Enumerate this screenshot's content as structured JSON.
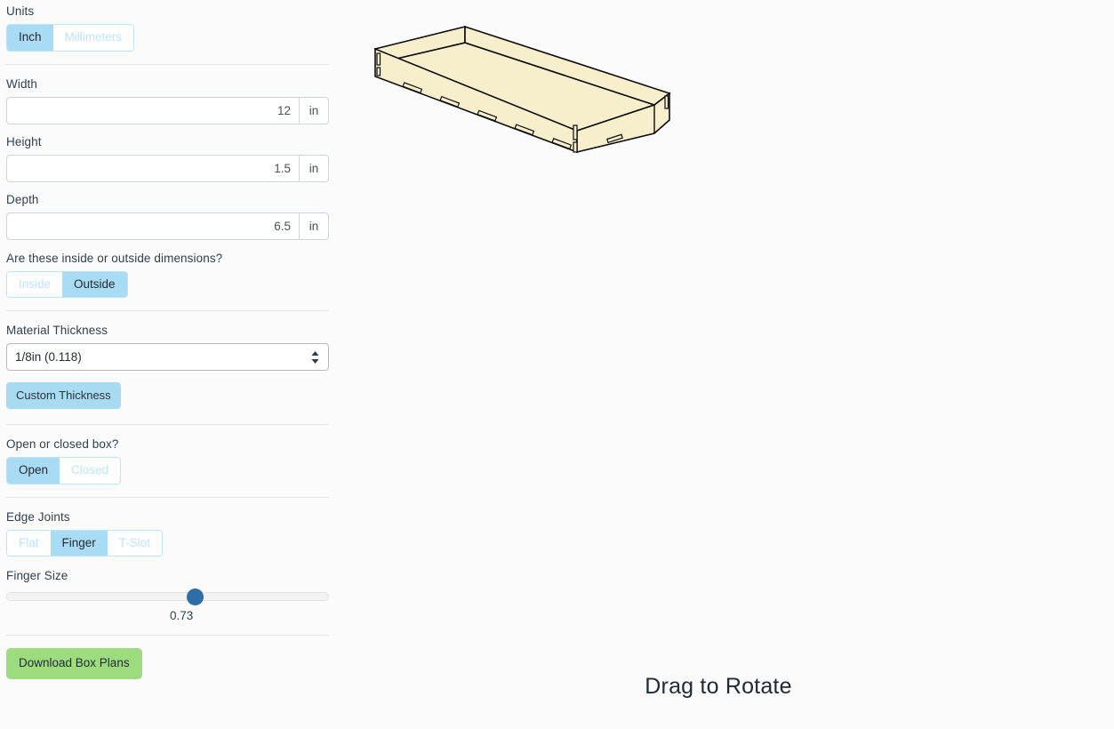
{
  "panel": {
    "units": {
      "label": "Units",
      "options": [
        {
          "label": "Inch",
          "selected": true
        },
        {
          "label": "Millimeters",
          "selected": false
        }
      ]
    },
    "width": {
      "label": "Width",
      "value": "12",
      "unit": "in",
      "placeholder": ""
    },
    "height": {
      "label": "Height",
      "value": "1.5",
      "unit": "in",
      "placeholder": ""
    },
    "depth": {
      "label": "Depth",
      "value": "6.5",
      "unit": "in",
      "placeholder": ""
    },
    "dimension_mode": {
      "label": "Are these inside or outside dimensions?",
      "options": [
        {
          "label": "Inside",
          "selected": false
        },
        {
          "label": "Outside",
          "selected": true
        }
      ]
    },
    "material_thickness": {
      "label": "Material Thickness",
      "selected": "1/8in (0.118)",
      "options": [
        "1/8in (0.118)"
      ],
      "custom_button": "Custom Thickness"
    },
    "box_type": {
      "label": "Open or closed box?",
      "options": [
        {
          "label": "Open",
          "selected": true
        },
        {
          "label": "Closed",
          "selected": false
        }
      ]
    },
    "edge_joints": {
      "label": "Edge Joints",
      "options": [
        {
          "label": "Flat",
          "selected": false
        },
        {
          "label": "Finger",
          "selected": true
        },
        {
          "label": "T-Slot",
          "selected": false
        }
      ]
    },
    "finger_size": {
      "label": "Finger Size",
      "value": "0.73",
      "percent": 59
    },
    "download_button": "Download Box Plans"
  },
  "viewport": {
    "drag_hint": "Drag to Rotate",
    "box_fill": "#f7efcb",
    "box_stroke": "#0c0c0c"
  },
  "colors": {
    "accent_blue": "#a8dcf4",
    "accent_blue_muted": "#bfe3f7",
    "green": "#9ddb7f",
    "slider_blue": "#2d6ea8",
    "text": "#2b333d",
    "background": "#fbfbfb"
  }
}
